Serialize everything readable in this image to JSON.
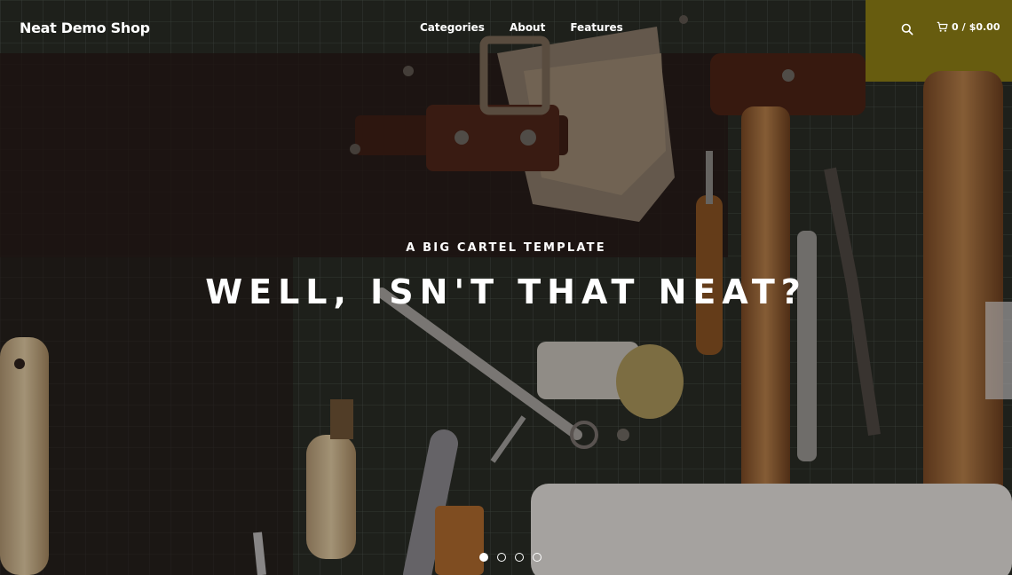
{
  "header": {
    "logo": "Neat Demo Shop",
    "nav": [
      {
        "label": "Categories"
      },
      {
        "label": "About"
      },
      {
        "label": "Features"
      }
    ],
    "search_icon": "search-icon",
    "cart": {
      "icon": "cart-icon",
      "count": "0",
      "separator": "/",
      "total": "$0.00"
    }
  },
  "hero": {
    "eyebrow": "A BIG CARTEL TEMPLATE",
    "headline": "WELL, ISN'T THAT NEAT?",
    "slides": {
      "count": 4,
      "active": 1
    }
  }
}
